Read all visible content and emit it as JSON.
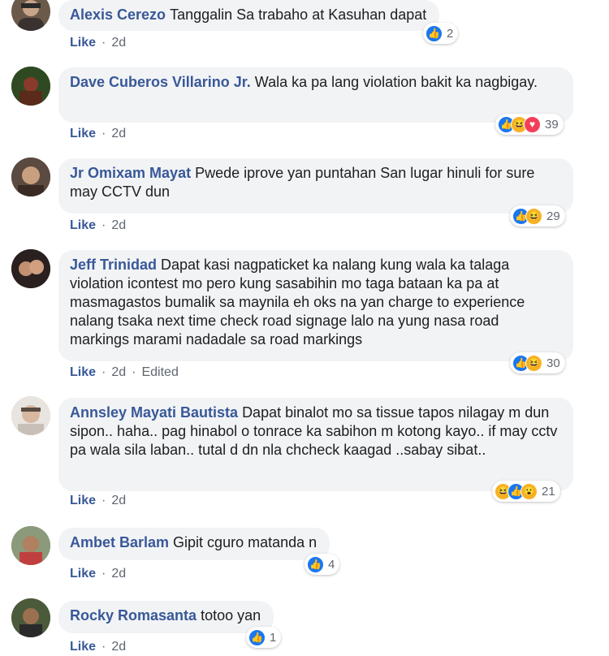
{
  "comments": [
    {
      "author": "Alexis Cerezo",
      "text": "Tanggalin Sa trabaho at Kasuhan dapat",
      "like": "Like",
      "time": "2d",
      "edited": "",
      "count": "2",
      "reactions": [
        "like"
      ],
      "avatar_color": "#6b5a4a"
    },
    {
      "author": "Dave Cuberos Villarino Jr.",
      "text": "Wala ka pa lang violation bakit ka nagbigay.",
      "like": "Like",
      "time": "2d",
      "edited": "",
      "count": "39",
      "reactions": [
        "like",
        "haha",
        "love"
      ],
      "avatar_color": "#3f5a2a"
    },
    {
      "author": "Jr Omixam Mayat",
      "text": "Pwede iprove yan puntahan San lugar hinuli for sure may CCTV dun",
      "like": "Like",
      "time": "2d",
      "edited": "",
      "count": "29",
      "reactions": [
        "like",
        "haha"
      ],
      "avatar_color": "#4a3b34"
    },
    {
      "author": "Jeff Trinidad",
      "text": "Dapat kasi nagpaticket ka nalang kung wala ka talaga violation icontest mo pero kung sasabihin mo taga bataan ka pa at masmagastos bumalik sa maynila eh oks na yan charge to experience nalang tsaka next time check road signage lalo na yung nasa road markings marami nadadale sa road markings",
      "like": "Like",
      "time": "2d",
      "edited": "Edited",
      "count": "30",
      "reactions": [
        "like",
        "haha"
      ],
      "avatar_color": "#3a2c2c"
    },
    {
      "author": "Annsley Mayati Bautista",
      "text": "Dapat binalot mo sa tissue tapos nilagay m dun sipon.. haha.. pag hinabol o tonrace ka sabihon m kotong kayo.. if may cctv pa wala sila laban.. tutal d dn nla chcheck kaagad ..sabay sibat..",
      "like": "Like",
      "time": "2d",
      "edited": "",
      "count": "21",
      "reactions": [
        "haha",
        "like",
        "wow"
      ],
      "avatar_color": "#d9d4cf"
    },
    {
      "author": "Ambet Barlam",
      "text": "Gipit cguro matanda n",
      "like": "Like",
      "time": "2d",
      "edited": "",
      "count": "4",
      "reactions": [
        "like"
      ],
      "avatar_color": "#7a8a6a"
    },
    {
      "author": "Rocky Romasanta",
      "text": "totoo yan",
      "like": "Like",
      "time": "2d",
      "edited": "",
      "count": "1",
      "reactions": [
        "like"
      ],
      "avatar_color": "#5b6a4a"
    }
  ],
  "colors": {
    "author": "#385898",
    "bubble": "#f2f3f5",
    "like": "#1877f2",
    "haha": "#f7b125",
    "love": "#f33e58"
  }
}
